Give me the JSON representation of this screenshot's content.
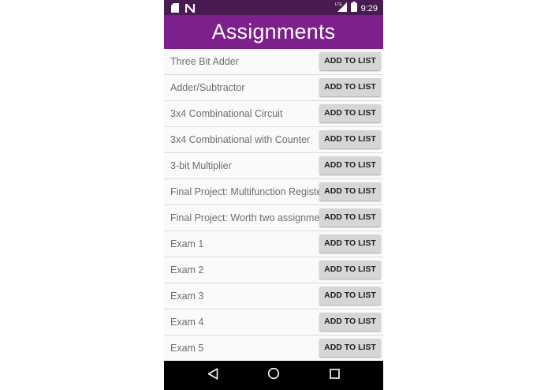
{
  "status_bar": {
    "time": "9:29",
    "network_label": "LTE",
    "icons": [
      "sd-card-icon",
      "n-notification-icon",
      "lte-signal-icon",
      "battery-icon"
    ]
  },
  "app_bar": {
    "title": "Assignments"
  },
  "assignments": [
    {
      "name": "Three Bit Adder",
      "button": "ADD TO LIST"
    },
    {
      "name": "Adder/Subtractor",
      "button": "ADD TO LIST"
    },
    {
      "name": "3x4 Combinational Circuit",
      "button": "ADD TO LIST"
    },
    {
      "name": "3x4 Combinational with Counter",
      "button": "ADD TO LIST"
    },
    {
      "name": "3-bit Multiplier",
      "button": "ADD TO LIST"
    },
    {
      "name": "Final Project: Multifunction Registe",
      "button": "ADD TO LIST"
    },
    {
      "name": "Final Project: Worth two assignmer",
      "button": "ADD TO LIST"
    },
    {
      "name": "Exam 1",
      "button": "ADD TO LIST"
    },
    {
      "name": "Exam 2",
      "button": "ADD TO LIST"
    },
    {
      "name": "Exam 3",
      "button": "ADD TO LIST"
    },
    {
      "name": "Exam 4",
      "button": "ADD TO LIST"
    },
    {
      "name": "Exam 5",
      "button": "ADD TO LIST"
    }
  ],
  "nav_bar": {
    "buttons": [
      "back-icon",
      "home-icon",
      "recents-icon"
    ]
  },
  "colors": {
    "status_bar": "#4a1a52",
    "app_bar": "#7d1f8c",
    "button_bg": "#d6d6d6",
    "nav_bar": "#000000"
  }
}
